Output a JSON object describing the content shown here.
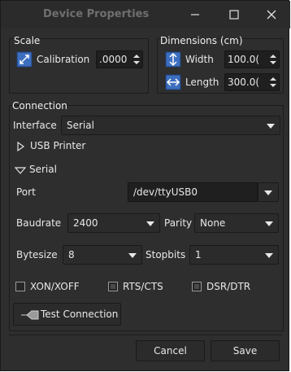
{
  "window": {
    "title": "Device Properties"
  },
  "scale": {
    "title": "Scale",
    "calibration_label": "Calibration",
    "calibration_value": ".0000"
  },
  "dimensions": {
    "title": "Dimensions (cm)",
    "width_label": "Width",
    "width_value": "100.0(",
    "length_label": "Length",
    "length_value": "300.0("
  },
  "connection": {
    "title": "Connection",
    "interface_label": "Interface",
    "interface_value": "Serial",
    "usb_label": "USB Printer",
    "serial_label": "Serial",
    "port_label": "Port",
    "port_value": "/dev/ttyUSB0",
    "baudrate_label": "Baudrate",
    "baudrate_value": "2400",
    "parity_label": "Parity",
    "parity_value": "None",
    "bytesize_label": "Bytesize",
    "bytesize_value": "8",
    "stopbits_label": "Stopbits",
    "stopbits_value": "1",
    "xonxoff_label": "XON/XOFF",
    "xonxoff_checked": false,
    "rtscts_label": "RTS/CTS",
    "rtscts_checked": true,
    "dsrdtr_label": "DSR/DTR",
    "dsrdtr_checked": true,
    "test_label": "Test Connection"
  },
  "footer": {
    "cancel_label": "Cancel",
    "save_label": "Save"
  }
}
